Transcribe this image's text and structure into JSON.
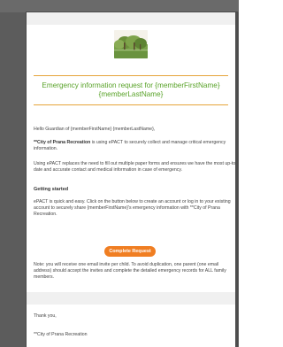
{
  "email": {
    "title": "Emergency information request for {memberFirstName} {memberLastName}",
    "greeting": "Hello Guardian of {memberFirstName} {memberLastName},",
    "intro_strong": "**City of Prana Recreation",
    "intro_rest": " is using ePACT to securely collect and manage critical emergency information.",
    "replace_text": "Using ePACT replaces the need to fill out multiple paper forms and ensures we have the most up-to-date and accurate contact and medical information in case of emergency.",
    "getting_started_heading": "Getting started",
    "getting_started_text": "ePACT is quick and easy. Click on the button below to create an account or log in to your existing account to securely share {memberFirstName}'s emergency information with **City of Prana Recreation.",
    "cta_label": "Complete Request",
    "note_text": "Note: you will receive one email invite per child. To avoid duplication, one parent (one email address) should accept the invites and complete the detailed emergency records for ALL family members.",
    "thanks": "Thank you,",
    "signature": "**City of Prana Recreation"
  },
  "colors": {
    "title_green": "#5aa32a",
    "cta_orange": "#f07e22",
    "divider_orange": "#e6a43a"
  },
  "icons": {
    "header_image": "park-photo"
  }
}
